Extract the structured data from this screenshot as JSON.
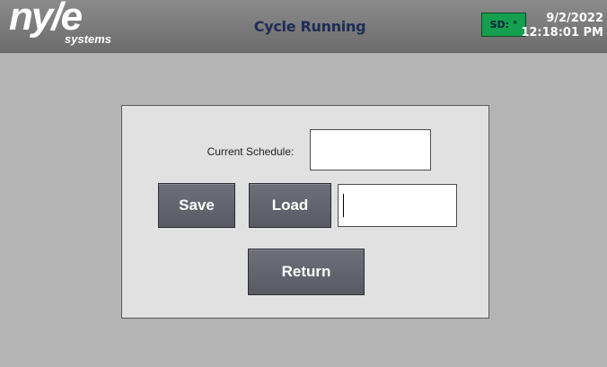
{
  "header": {
    "logo_main": "ny/e",
    "logo_sub": "systems",
    "title": "Cycle Running",
    "sd_label": "SD: °",
    "date": "9/2/2022",
    "time": "12:18:01 PM"
  },
  "panel": {
    "current_schedule_label": "Current Schedule:",
    "current_schedule_value": "",
    "schedule_name_value": "",
    "save_label": "Save",
    "load_label": "Load",
    "return_label": "Return"
  },
  "colors": {
    "background": "#b4b4b4",
    "header": "#7a7a7a",
    "panel": "#e1e1e1",
    "button": "#62626c",
    "sd_badge": "#14a04e",
    "title_text": "#1f2c57"
  }
}
